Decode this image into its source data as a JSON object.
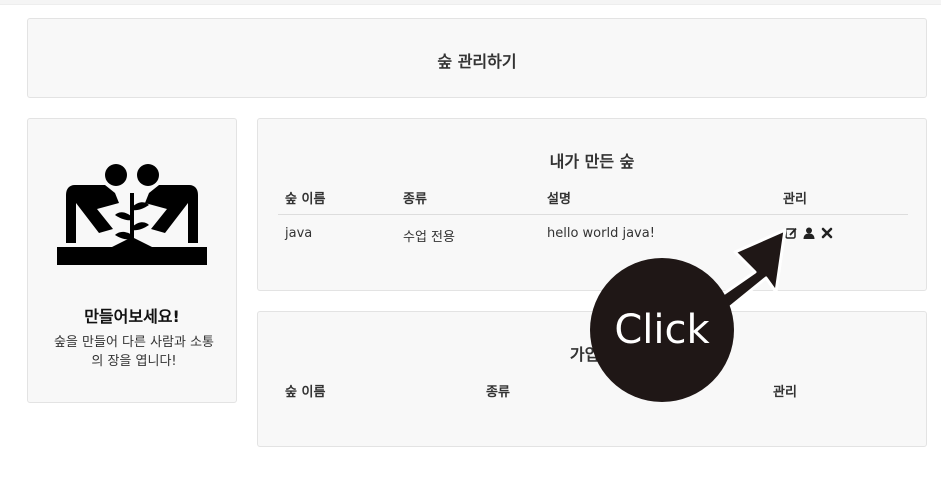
{
  "header": {
    "title": "숲 관리하기"
  },
  "sidebar": {
    "icon": "people-planting-icon",
    "title": "만들어보세요!",
    "description": "숲을 만들어 다른 사람과 소통의 장을 엽니다!"
  },
  "my_forests": {
    "title": "내가 만든 숲",
    "columns": [
      "숲 이름",
      "종류",
      "설명",
      "관리"
    ],
    "rows": [
      {
        "name": "java",
        "type": "수업 전용",
        "description": "hello world java!"
      }
    ],
    "row_actions": [
      "edit-icon",
      "user-icon",
      "delete-icon"
    ]
  },
  "joined_forests": {
    "title": "가입한",
    "columns": [
      "숲 이름",
      "종류",
      "",
      "관리"
    ]
  },
  "overlay": {
    "label": "Click",
    "color": "#1f1716"
  }
}
